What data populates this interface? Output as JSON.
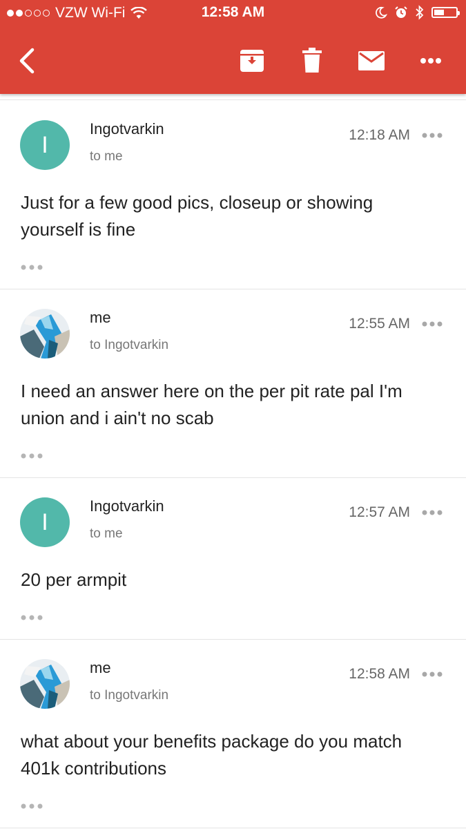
{
  "status_bar": {
    "carrier": "VZW Wi-Fi",
    "time": "12:58 AM",
    "signal_dots_filled": 2,
    "signal_dots_total": 5,
    "battery_level": 0.4
  },
  "toolbar": {
    "icons": [
      "back-icon",
      "archive-icon",
      "delete-icon",
      "mail-icon",
      "more-icon"
    ],
    "color": "#db4437"
  },
  "messages": [
    {
      "sender": "Ingotvarkin",
      "recipient": "to me",
      "time": "12:18 AM",
      "avatar_letter": "I",
      "body": "Just for a few good pics, closeup or showing yourself is fine"
    },
    {
      "sender": "me",
      "recipient": "to Ingotvarkin",
      "time": "12:55 AM",
      "avatar_letter": "",
      "body": "I need an answer here on the per pit rate pal I'm union and i ain't no scab"
    },
    {
      "sender": "Ingotvarkin",
      "recipient": "to me",
      "time": "12:57 AM",
      "avatar_letter": "I",
      "body": "20 per armpit"
    },
    {
      "sender": "me",
      "recipient": "to Ingotvarkin",
      "time": "12:58 AM",
      "avatar_letter": "",
      "body": "what about your benefits package do you match 401k contributions"
    }
  ]
}
